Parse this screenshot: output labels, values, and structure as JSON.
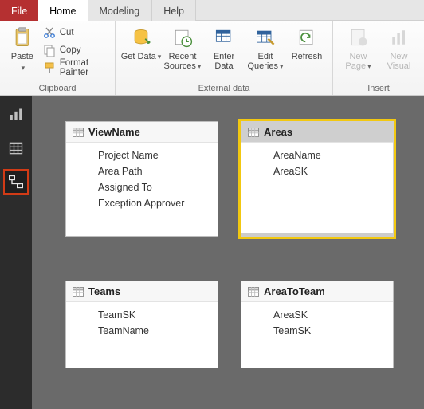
{
  "tabs": {
    "file": "File",
    "home": "Home",
    "modeling": "Modeling",
    "help": "Help"
  },
  "ribbon": {
    "paste": "Paste",
    "cut": "Cut",
    "copy": "Copy",
    "format_painter": "Format Painter",
    "clipboard_group": "Clipboard",
    "get_data": "Get Data",
    "recent_sources": "Recent Sources",
    "enter_data": "Enter Data",
    "edit_queries": "Edit Queries",
    "refresh": "Refresh",
    "external_group": "External data",
    "new_page": "New Page",
    "new_visual": "New Visual",
    "insert_group": "Insert"
  },
  "entities": {
    "viewname": {
      "title": "ViewName",
      "fields": [
        "Project Name",
        "Area Path",
        "Assigned To",
        "Exception Approver"
      ]
    },
    "areas": {
      "title": "Areas",
      "fields": [
        "AreaName",
        "AreaSK"
      ]
    },
    "teams": {
      "title": "Teams",
      "fields": [
        "TeamSK",
        "TeamName"
      ]
    },
    "areatoteam": {
      "title": "AreaToTeam",
      "fields": [
        "AreaSK",
        "TeamSK"
      ]
    }
  }
}
